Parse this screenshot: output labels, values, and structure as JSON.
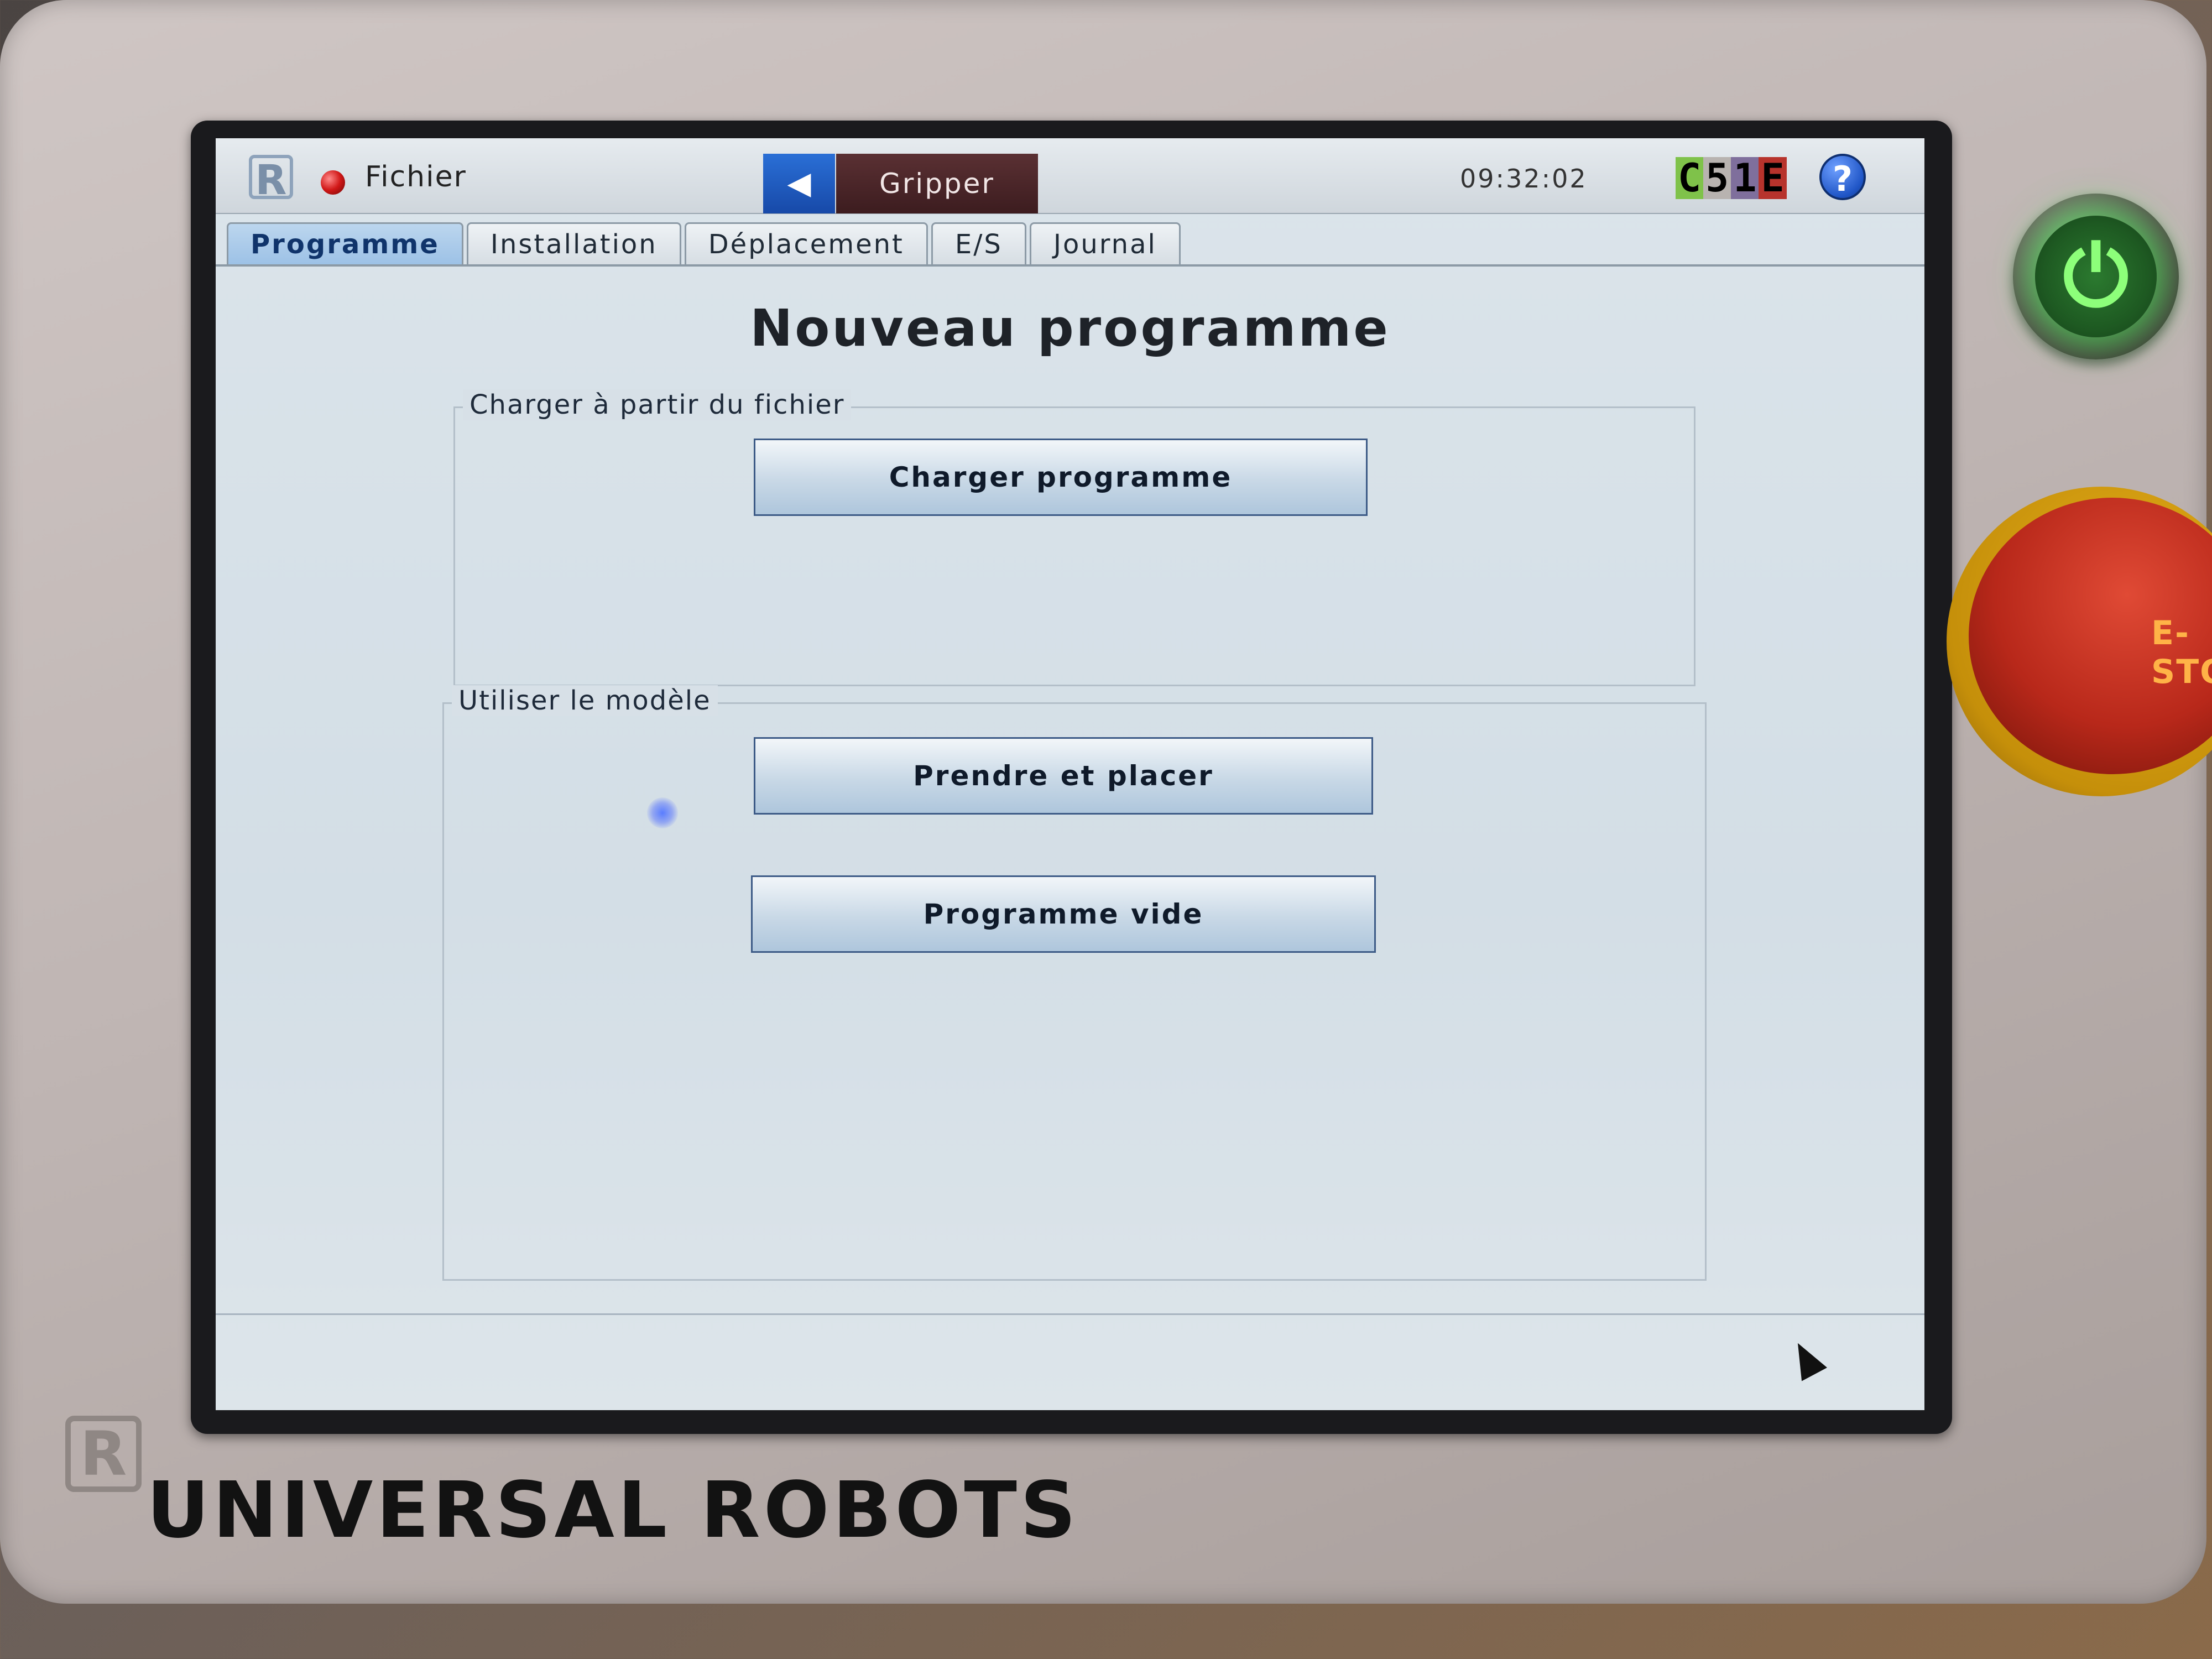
{
  "topbar": {
    "file_label": "Fichier",
    "back_icon": "◀",
    "program_name": "Gripper",
    "clock": "09:32:02",
    "speed_badge": [
      "C",
      "5",
      "1",
      "E"
    ],
    "speed_badge_colors": [
      "#7fc24a",
      "#b8b3b0",
      "#7f6f9c",
      "#b7332c"
    ],
    "help_label": "?"
  },
  "tabs": [
    "Programme",
    "Installation",
    "Déplacement",
    "E/S",
    "Journal"
  ],
  "active_tab": "Programme",
  "page_title": "Nouveau programme",
  "load_group": {
    "legend": "Charger à partir du fichier",
    "load_button": "Charger programme"
  },
  "template_group": {
    "legend": "Utiliser le modèle",
    "pick_place_button": "Prendre et placer",
    "empty_button": "Programme vide"
  },
  "hardware": {
    "power_icon": "⏻",
    "estop_label": "E-STO",
    "brand_logo": "R",
    "brand_name": "UNIVERSAL ROBOTS"
  },
  "colors": {
    "accent": "#1f55c6",
    "status_dot": "#d11818",
    "power_glow": "#3cff50",
    "estop": "#b8281a"
  }
}
